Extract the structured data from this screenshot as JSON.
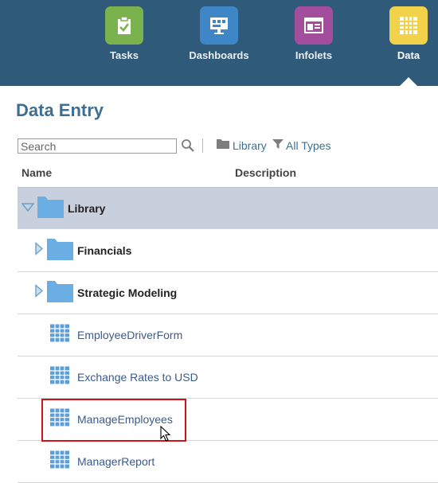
{
  "nav": {
    "items": [
      {
        "label": "Tasks",
        "color": "#7ab24d",
        "icon": "clipboard-check-icon"
      },
      {
        "label": "Dashboards",
        "color": "#3f86c6",
        "icon": "monitor-icon"
      },
      {
        "label": "Infolets",
        "color": "#a34e9c",
        "icon": "infolet-card-icon"
      },
      {
        "label": "Data",
        "color": "#f2d24a",
        "icon": "data-grid-icon",
        "active": true
      }
    ]
  },
  "page": {
    "title": "Data Entry"
  },
  "toolbar": {
    "search_placeholder": "Search",
    "library_label": "Library",
    "types_label": "All Types"
  },
  "columns": {
    "name": "Name",
    "description": "Description"
  },
  "tree": {
    "rows": [
      {
        "label": "Library",
        "kind": "folder",
        "state": "expanded",
        "selected": true
      },
      {
        "label": "Financials",
        "kind": "folder",
        "state": "collapsed"
      },
      {
        "label": "Strategic Modeling",
        "kind": "folder",
        "state": "collapsed"
      },
      {
        "label": "EmployeeDriverForm",
        "kind": "form"
      },
      {
        "label": "Exchange Rates to USD",
        "kind": "form"
      },
      {
        "label": "ManageEmployees",
        "kind": "form",
        "highlighted": true
      },
      {
        "label": "ManagerReport",
        "kind": "form"
      }
    ]
  }
}
